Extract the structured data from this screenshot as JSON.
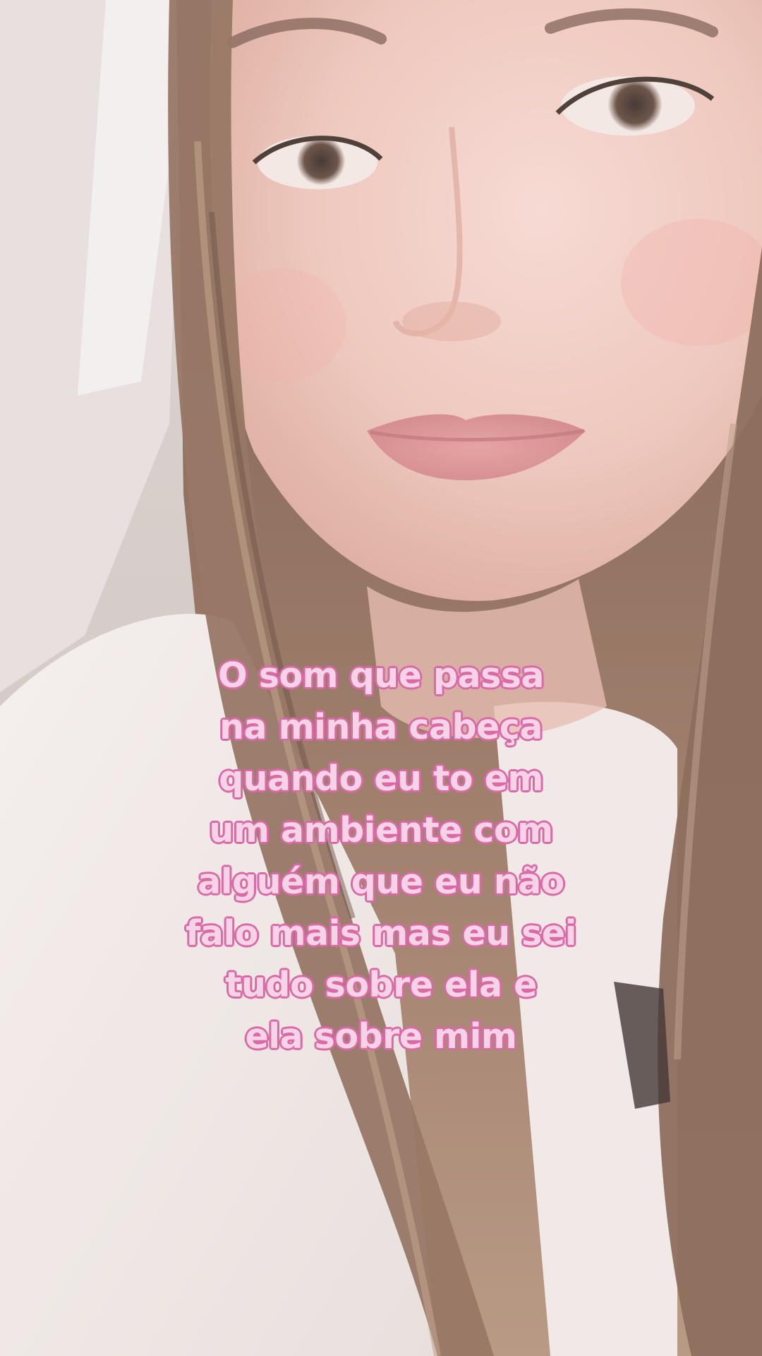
{
  "caption": {
    "lines": [
      "O som que passa",
      "na minha cabeça",
      "quando eu to em",
      "um ambiente com",
      "alguém que eu não",
      "falo mais mas eu sei",
      "tudo sobre ela e",
      "ela sobre mim"
    ]
  },
  "colors": {
    "caption_fill": "#f7d3e8",
    "caption_outline": "#d96aa5"
  }
}
